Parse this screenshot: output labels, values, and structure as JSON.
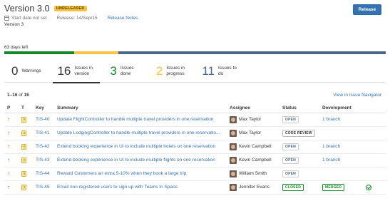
{
  "header": {
    "title": "Version 3.0",
    "badge": "UNRELEASED",
    "start_date": "Start date not set",
    "release_date": "Release: 14/Sep/15",
    "release_notes": "Release Notes",
    "description": "Version 3",
    "release_button": "Release"
  },
  "progress": {
    "days_left": "63 days left",
    "segments": [
      {
        "name": "done",
        "fraction": 0.183,
        "color": "#14892c"
      },
      {
        "name": "in-progress",
        "fraction": 0.116,
        "color": "#f6c342"
      },
      {
        "name": "to-do",
        "fraction": 0.701,
        "color": "#4a6785"
      }
    ]
  },
  "stats": [
    {
      "num": "0",
      "label": "Warnings",
      "color": "#333333",
      "active": false
    },
    {
      "num": "16",
      "label": "Issues in version",
      "color": "#333333",
      "active": true
    },
    {
      "num": "3",
      "label": "Issues done",
      "color": "#14892c",
      "active": false
    },
    {
      "num": "2",
      "label": "Issues in progress",
      "color": "#f6c342",
      "active": false
    },
    {
      "num": "11",
      "label": "Issues to do",
      "color": "#4a6785",
      "active": false
    }
  ],
  "list": {
    "count_range": "1–16",
    "count_of": "of",
    "count_total": "16",
    "view_navigator": "View in Issue Navigator",
    "columns": {
      "p": "P",
      "t": "T",
      "key": "Key",
      "summary": "Summary",
      "assignee": "Assignee",
      "status": "Status",
      "development": "Development"
    }
  },
  "issues": [
    {
      "key": "TIS-40",
      "summary": "Update FlightController to handle multiple travel providers in one reservation",
      "assignee": "Max Taylor",
      "status": "OPEN",
      "status_type": "open",
      "dev": "1 branch",
      "dev_type": "link"
    },
    {
      "key": "TIS-41",
      "summary": "Update LodgingController to handle multiple travel providers in one reservatio...",
      "assignee": "Max Taylor",
      "status": "CODE REVIEW",
      "status_type": "review",
      "dev": "",
      "dev_type": "none"
    },
    {
      "key": "TIS-42",
      "summary": "Extend booking experience in UI to include multiple hotels on one reservation",
      "assignee": "Kevin Campbell",
      "status": "OPEN",
      "status_type": "open",
      "dev": "1 branch",
      "dev_type": "link"
    },
    {
      "key": "TIS-43",
      "summary": "Extend booking experience in UI to include multiple flights on one reservation",
      "assignee": "Kevin Campbell",
      "status": "OPEN",
      "status_type": "open",
      "dev": "1 branch",
      "dev_type": "link"
    },
    {
      "key": "TIS-44",
      "summary": "Reward Customers an extra 5-10% when they book a large trip",
      "assignee": "William Smith",
      "status": "OPEN",
      "status_type": "open",
      "dev": "",
      "dev_type": "none"
    },
    {
      "key": "TIS-45",
      "summary": "Email non registered users to sign up with Teams In Space",
      "assignee": "Jennifer Evans",
      "status": "CLOSED",
      "status_type": "closed",
      "dev": "MERGED",
      "dev_type": "merged"
    }
  ],
  "icons": {
    "priority": "arrow-up-icon",
    "type": "story-icon",
    "calendar": "calendar-icon",
    "merged_check": "check-circle-icon"
  }
}
